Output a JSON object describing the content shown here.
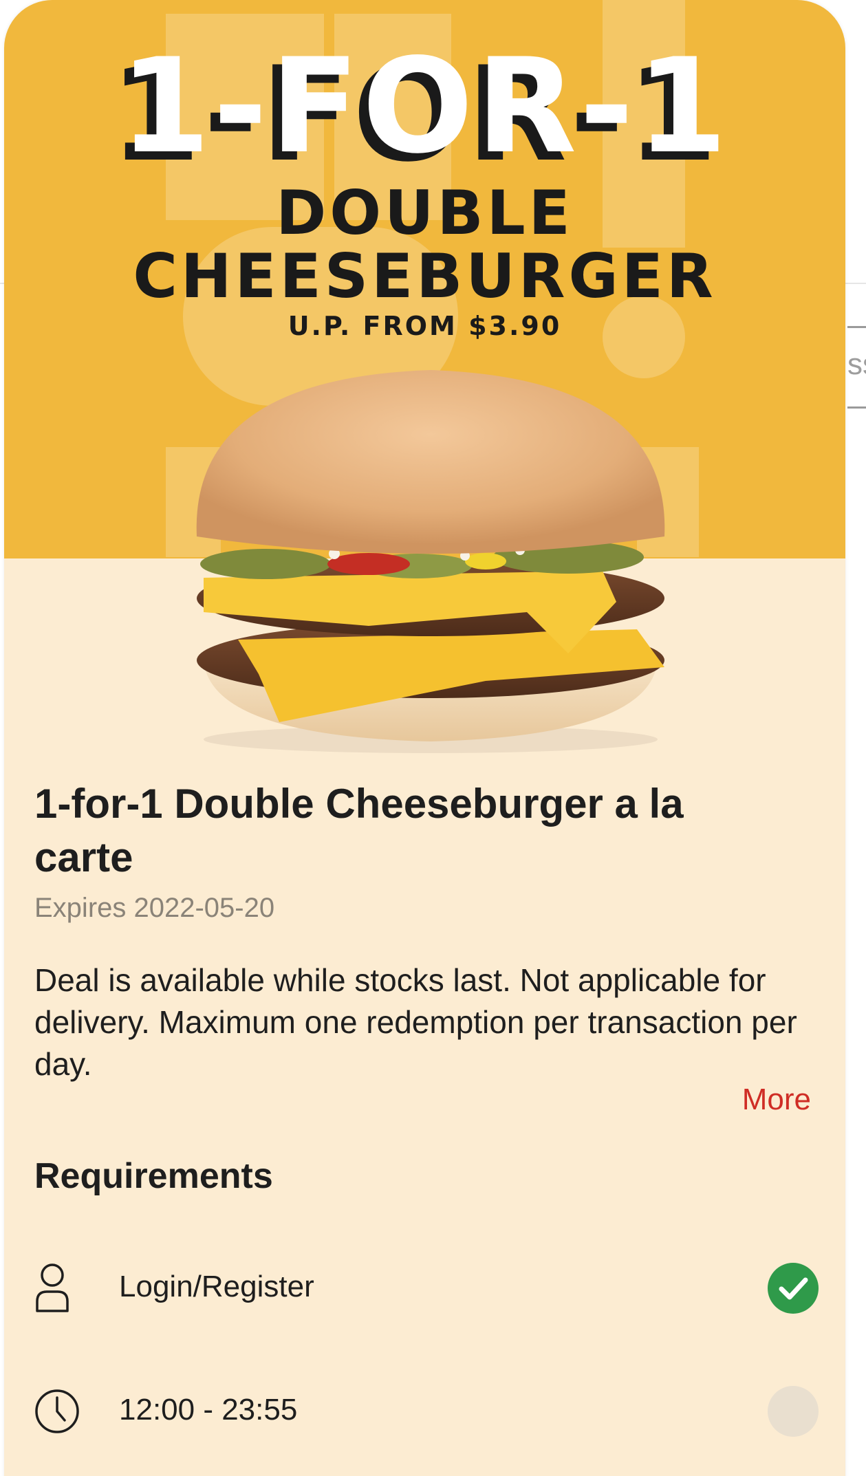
{
  "background_page": {
    "field_fragment": "ss"
  },
  "offer": {
    "hero": {
      "headline": "1-FOR-1",
      "product_line1": "DOUBLE",
      "product_line2": "CHEESEBURGER",
      "price_note": "U.P. FROM $3.90"
    },
    "title": " 1-for-1 Double Cheeseburger a la carte",
    "expires": "Expires 2022-05-20",
    "description": "Deal is available while stocks last. Not applicable for delivery. Maximum one redemption per transaction per day.",
    "more_label": "More"
  },
  "requirements": {
    "heading": "Requirements",
    "items": [
      {
        "icon": "person-icon",
        "label": "Login/Register",
        "status": "done"
      },
      {
        "icon": "clock-icon",
        "label": "12:00 - 23:55",
        "status": "pending"
      }
    ]
  },
  "colors": {
    "hero_bg": "#f1b83d",
    "card_bg": "#fcecd2",
    "accent_red": "#cf2d25",
    "status_green": "#2f9a4a"
  }
}
